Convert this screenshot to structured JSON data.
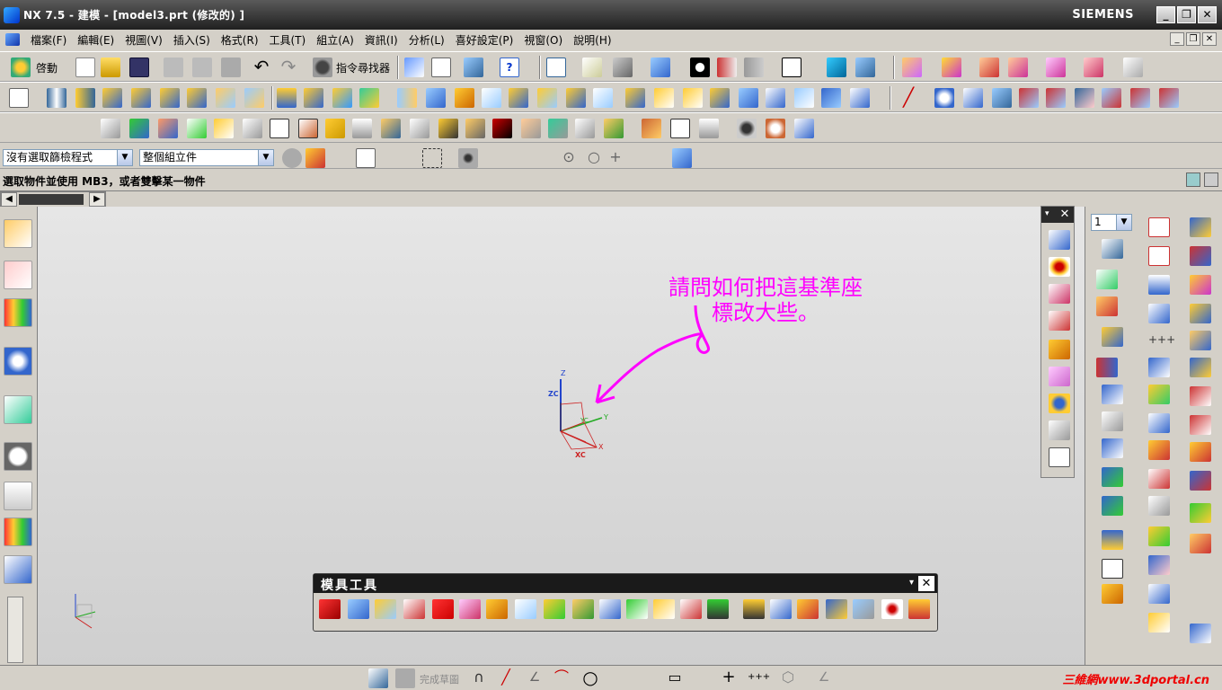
{
  "window": {
    "title": "NX 7.5 - 建模 - [model3.prt (修改的) ]",
    "brand": "SIEMENS",
    "controls": [
      "_",
      "❐",
      "✕"
    ]
  },
  "menubar": {
    "items": [
      "檔案(F)",
      "編輯(E)",
      "視圖(V)",
      "插入(S)",
      "格式(R)",
      "工具(T)",
      "組立(A)",
      "資訊(I)",
      "分析(L)",
      "喜好設定(P)",
      "視窗(O)",
      "說明(H)"
    ]
  },
  "toolbar": {
    "start_label": "啓動",
    "command_finder_label": "指令尋找器"
  },
  "selection": {
    "filter_value": "沒有選取篩檢程式",
    "scope_value": "整個組立件"
  },
  "status": {
    "prompt": "選取物件並使用 MB3，或者雙擊某一物件"
  },
  "graphics": {
    "wcs_labels": {
      "z": "Z",
      "zc": "ZC",
      "y": "Y",
      "x": "X",
      "xc": "XC",
      "yc": "YC"
    },
    "annotation_line1": "請問如何把這基準座",
    "annotation_line2": "標改大些。",
    "annotation_color": "#ff00ff"
  },
  "right_dock": {
    "layer_value": "1"
  },
  "mold_tools": {
    "title": "模具工具",
    "close": "✕"
  },
  "sketch_toolbar": {
    "finish_label": "完成草圖"
  },
  "watermark": "三維網www.3dportal.cn"
}
